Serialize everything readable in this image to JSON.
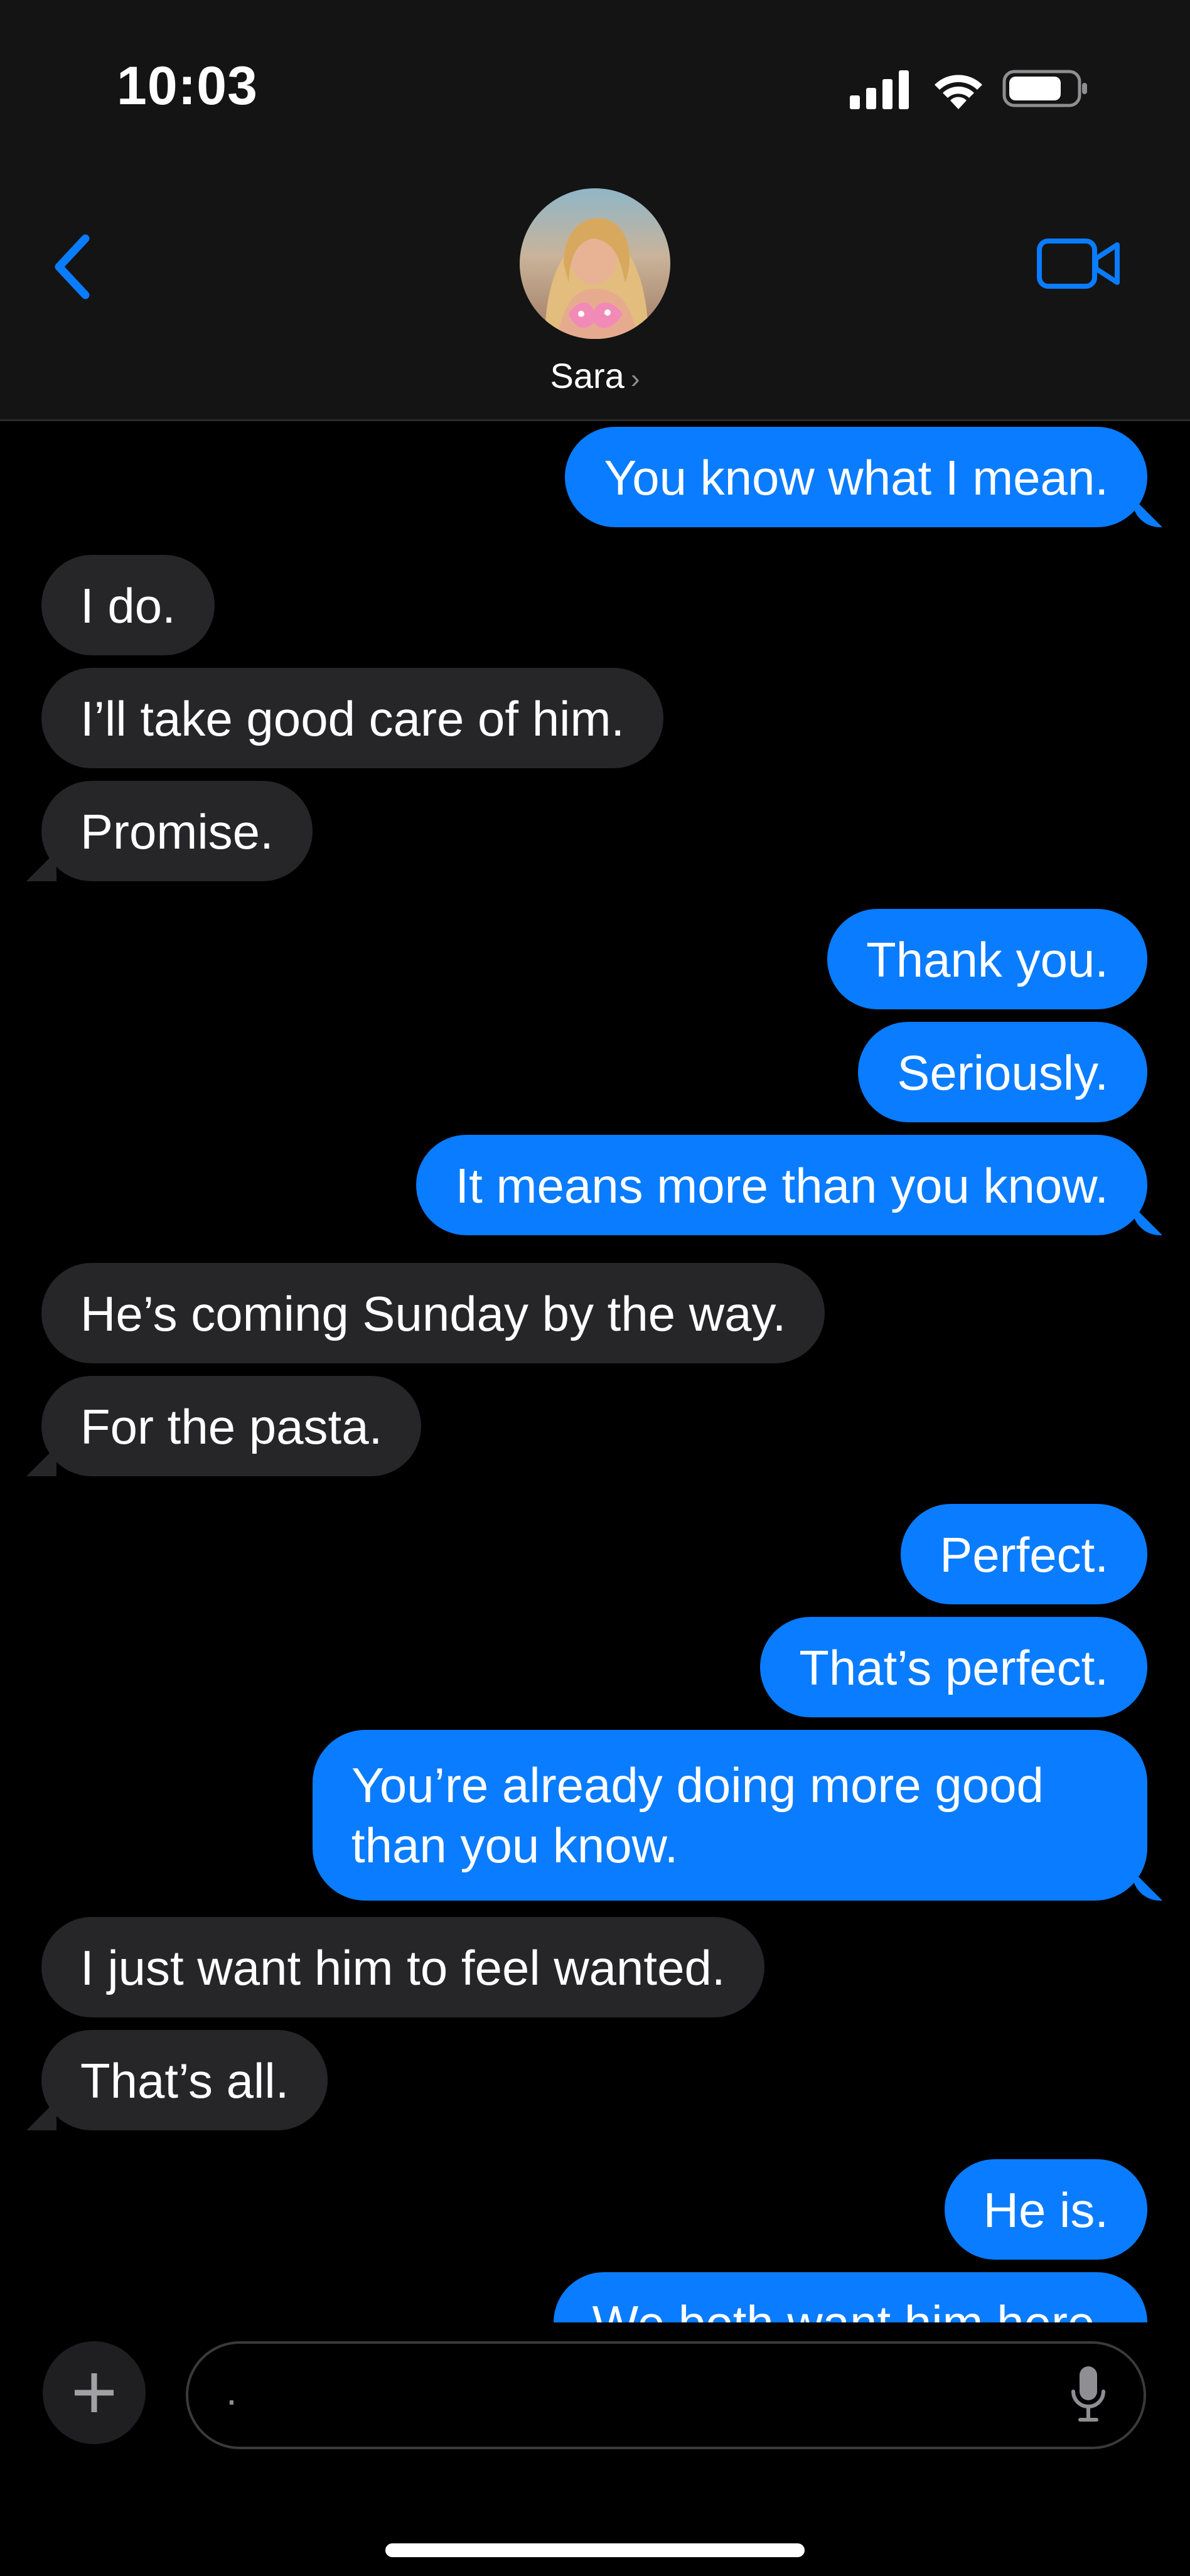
{
  "status_bar": {
    "time": "10:03"
  },
  "header": {
    "contact_name": "Sara",
    "contact_chevron": "›",
    "back_icon": "chevron-left-icon",
    "video_icon": "video-camera-icon",
    "accent_color": "#0a7cff"
  },
  "messages": [
    {
      "from": "me",
      "text": "You know what I mean."
    },
    {
      "from": "them",
      "text": "I do."
    },
    {
      "from": "them",
      "text": "I’ll take good care of him."
    },
    {
      "from": "them",
      "text": "Promise."
    },
    {
      "from": "me",
      "text": "Thank you."
    },
    {
      "from": "me",
      "text": "Seriously."
    },
    {
      "from": "me",
      "text": "It means more than you know."
    },
    {
      "from": "them",
      "text": "He’s coming Sunday by the way."
    },
    {
      "from": "them",
      "text": "For the pasta."
    },
    {
      "from": "me",
      "text": "Perfect."
    },
    {
      "from": "me",
      "text": "That’s perfect."
    },
    {
      "from": "me",
      "text": "You’re already doing more good than you know."
    },
    {
      "from": "them",
      "text": "I just want him to feel wanted."
    },
    {
      "from": "them",
      "text": "That’s all."
    },
    {
      "from": "me",
      "text": "He is."
    },
    {
      "from": "me",
      "text": "We both want him here."
    }
  ],
  "composer": {
    "input_value": ".",
    "plus_icon": "plus-icon",
    "mic_icon": "microphone-icon"
  }
}
